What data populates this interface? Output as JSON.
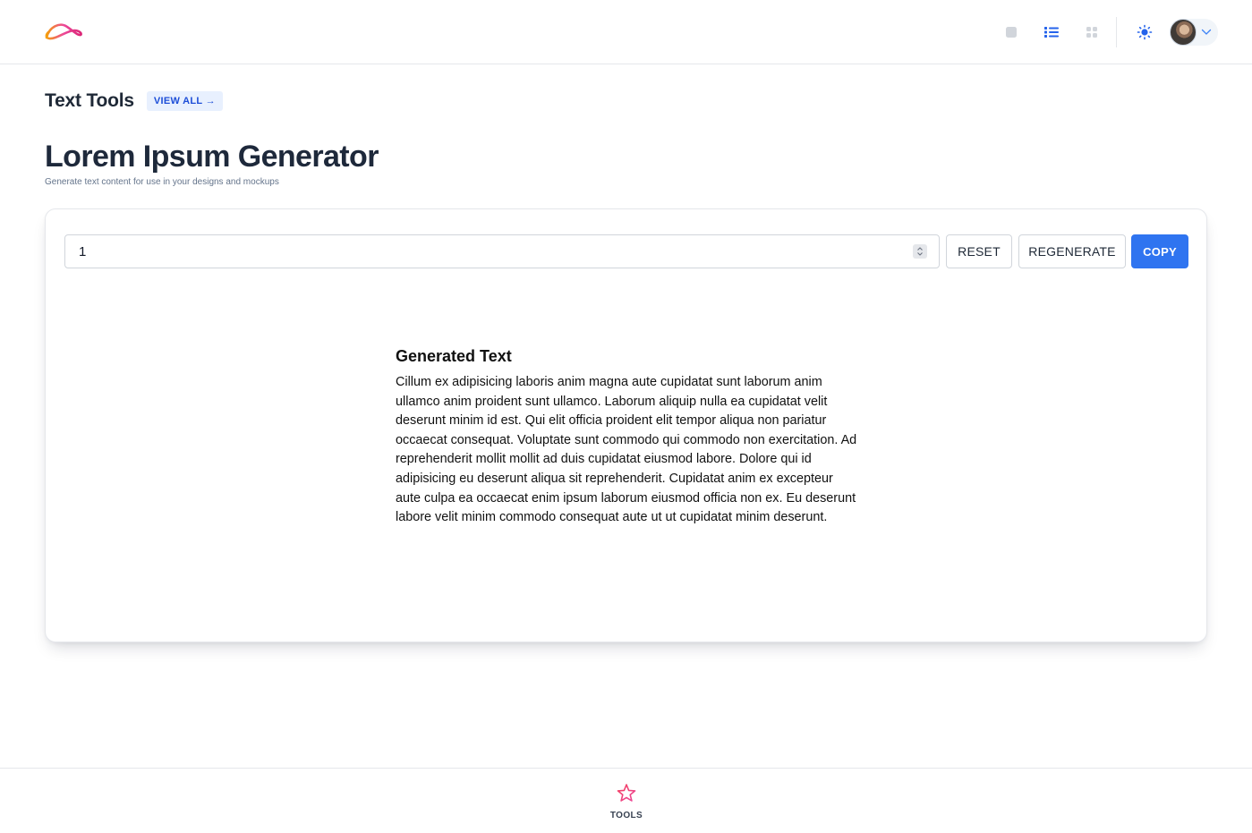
{
  "header": {
    "logo_icon": "swoosh-logo-icon",
    "icons": [
      "square-view-icon",
      "list-view-icon",
      "grid-view-icon",
      "sun-icon",
      "avatar",
      "chevron-down-icon"
    ],
    "accent": "#2563eb"
  },
  "section": {
    "title": "Text Tools",
    "view_all": "VIEW ALL →"
  },
  "page": {
    "title": "Lorem Ipsum Generator",
    "subtitle": "Generate text content for use in your designs and mockups"
  },
  "controls": {
    "paragraph_count": "1",
    "reset_label": "RESET",
    "regenerate_label": "REGENERATE",
    "copy_label": "COPY",
    "copy_color": "#2f74f0"
  },
  "output": {
    "title": "Generated Text",
    "text": "Cillum ex adipisicing laboris anim magna aute cupidatat sunt laborum anim ullamco anim proident sunt ullamco. Laborum aliquip nulla ea cupidatat velit deserunt minim id est. Qui elit officia proident elit tempor aliqua non pariatur occaecat consequat. Voluptate sunt commodo qui commodo non exercitation. Ad reprehenderit mollit mollit ad duis cupidatat eiusmod labore. Dolore qui id adipisicing eu deserunt aliqua sit reprehenderit. Cupidatat anim ex excepteur aute culpa ea occaecat enim ipsum laborum eiusmod officia non ex. Eu deserunt labore velit minim commodo consequat aute ut ut cupidatat minim deserunt."
  },
  "bottom_nav": {
    "tools_label": "TOOLS",
    "tools_icon": "star-icon"
  }
}
